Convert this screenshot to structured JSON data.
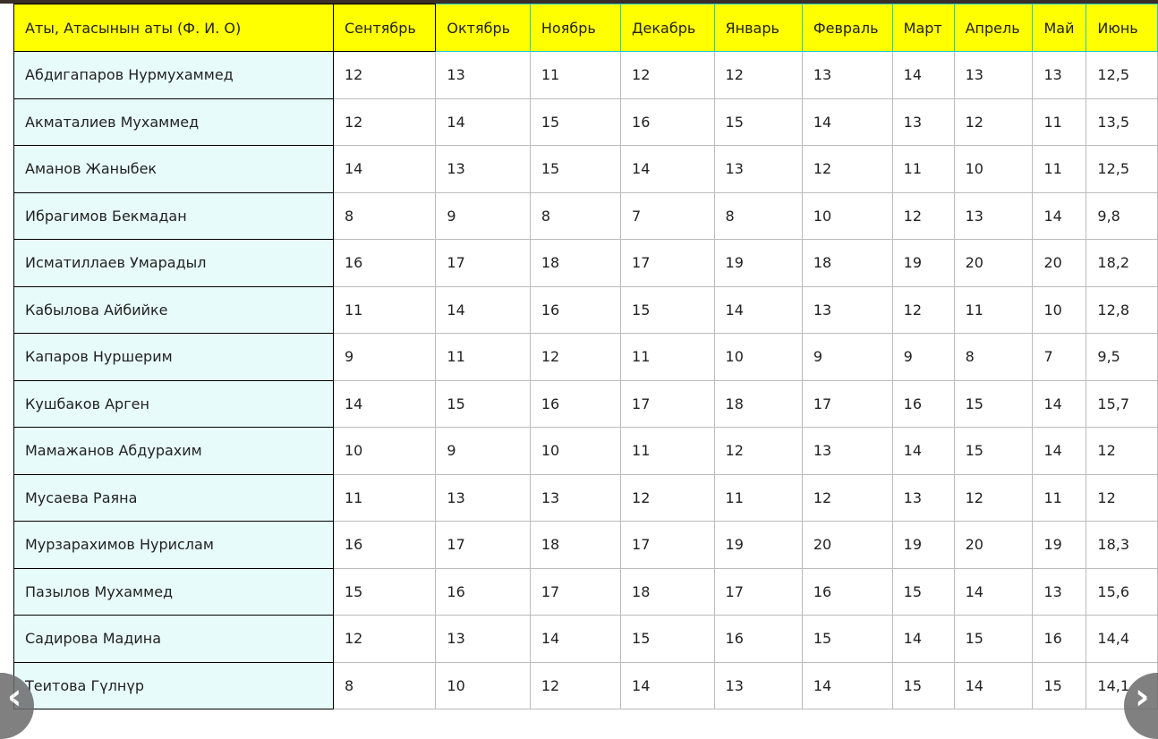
{
  "header": [
    "Аты, Атасынын аты (Ф. И. О)",
    "Сентябрь",
    "Октябрь",
    "Ноябрь",
    "Декабрь",
    "Январь",
    "Февраль",
    "Март",
    "Апрель",
    "Май",
    "Июнь"
  ],
  "rows": [
    {
      "name": "Абдигапаров Нурмухаммед",
      "values": [
        "12",
        "13",
        "11",
        "12",
        "12",
        "13",
        "14",
        "13",
        "13",
        "12,5"
      ]
    },
    {
      "name": "Акматалиев Мухаммед",
      "values": [
        "12",
        "14",
        "15",
        "16",
        "15",
        "14",
        "13",
        "12",
        "11",
        "13,5"
      ]
    },
    {
      "name": "Аманов Жаныбек",
      "values": [
        "14",
        "13",
        "15",
        "14",
        "13",
        "12",
        "11",
        "10",
        "11",
        "12,5"
      ]
    },
    {
      "name": "Ибрагимов Бекмадан",
      "values": [
        "8",
        "9",
        "8",
        "7",
        "8",
        "10",
        "12",
        "13",
        "14",
        "9,8"
      ]
    },
    {
      "name": "Исматиллаев Умарадыл",
      "values": [
        "16",
        "17",
        "18",
        "17",
        "19",
        "18",
        "19",
        "20",
        "20",
        "18,2"
      ]
    },
    {
      "name": "Кабылова Айбийке",
      "values": [
        "11",
        "14",
        "16",
        "15",
        "14",
        "13",
        "12",
        "11",
        "10",
        "12,8"
      ]
    },
    {
      "name": "Капаров Нуршерим",
      "values": [
        "9",
        "11",
        "12",
        "11",
        "10",
        "9",
        "9",
        "8",
        "7",
        "9,5"
      ]
    },
    {
      "name": "Кушбаков Арген",
      "values": [
        "14",
        "15",
        "16",
        "17",
        "18",
        "17",
        "16",
        "15",
        "14",
        "15,7"
      ]
    },
    {
      "name": "Мамажанов Абдурахим",
      "values": [
        "10",
        "9",
        "10",
        "11",
        "12",
        "13",
        "14",
        "15",
        "14",
        "12"
      ]
    },
    {
      "name": "Мусаева Раяна",
      "values": [
        "11",
        "13",
        "13",
        "12",
        "11",
        "12",
        "13",
        "12",
        "11",
        "12"
      ]
    },
    {
      "name": "Мурзарахимов Нурислам",
      "values": [
        "16",
        "17",
        "18",
        "17",
        "19",
        "20",
        "19",
        "20",
        "19",
        "18,3"
      ]
    },
    {
      "name": "Пазылов Мухаммед",
      "values": [
        "15",
        "16",
        "17",
        "18",
        "17",
        "16",
        "15",
        "14",
        "13",
        "15,6"
      ]
    },
    {
      "name": "Садирова Мадина",
      "values": [
        "12",
        "13",
        "14",
        "15",
        "16",
        "15",
        "14",
        "15",
        "16",
        "14,4"
      ]
    },
    {
      "name": "Теитова Гүлнүр",
      "values": [
        "8",
        "10",
        "12",
        "14",
        "13",
        "14",
        "15",
        "14",
        "15",
        "14,1"
      ]
    }
  ],
  "nav": {
    "prev_icon": "‹",
    "next_icon": "›"
  }
}
